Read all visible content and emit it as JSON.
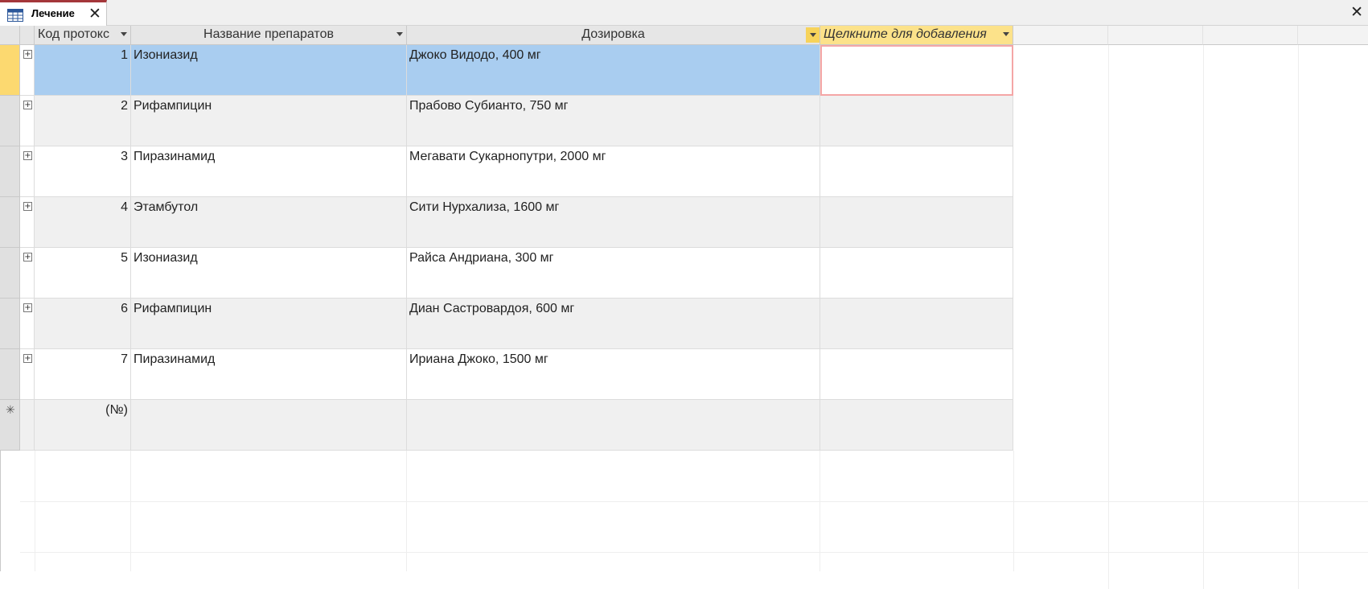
{
  "tab": {
    "title": "Лечение",
    "icon": "table-icon"
  },
  "columns": [
    {
      "label": "Код протокс"
    },
    {
      "label": "Название препаратов"
    },
    {
      "label": "Дозировка"
    },
    {
      "label": "Щелкните для добавления"
    }
  ],
  "rows": [
    {
      "id": "1",
      "drug": "Изониазид",
      "dose": "Джоко Видодо, 400 мг"
    },
    {
      "id": "2",
      "drug": "Рифампицин",
      "dose": "Прабово Субианто, 750 мг"
    },
    {
      "id": "3",
      "drug": "Пиразинамид",
      "dose": "Мегавати Сукарнопутри, 2000 мг"
    },
    {
      "id": "4",
      "drug": "Этамбутол",
      "dose": "Сити Нурхализа, 1600 мг"
    },
    {
      "id": "5",
      "drug": "Изониазид",
      "dose": "Райса Андриана, 300 мг"
    },
    {
      "id": "6",
      "drug": "Рифампицин",
      "dose": "Диан Састровардоя, 600 мг"
    },
    {
      "id": "7",
      "drug": "Пиразинамид",
      "dose": "Ириана Джоко, 1500 мг"
    }
  ],
  "new_row": {
    "id_placeholder": "(№)"
  },
  "colors": {
    "selected_row": "#a9cdf0",
    "current_selector": "#fcd970",
    "add_column_header": "#fce28a",
    "tab_accent": "#a4373a",
    "alt_row": "#f0f0f0"
  }
}
